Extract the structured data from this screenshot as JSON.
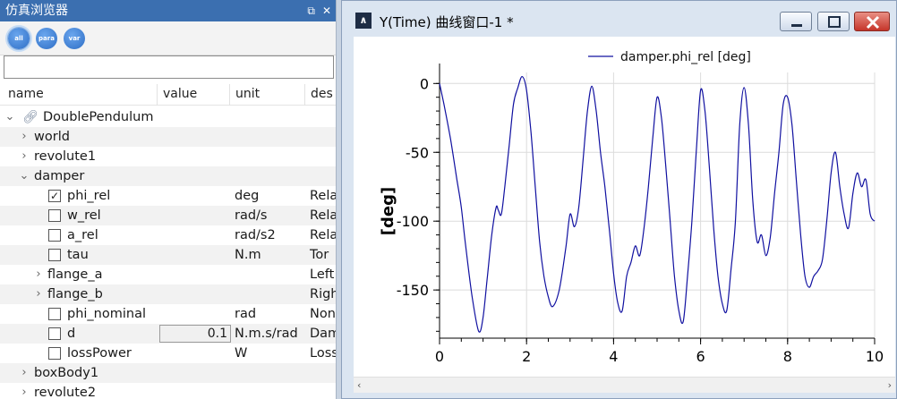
{
  "browser": {
    "title": "仿真浏览器",
    "filters": [
      "all",
      "para",
      "var"
    ],
    "search": {
      "value": "",
      "placeholder": ""
    },
    "columns": {
      "name": "name",
      "value": "value",
      "unit": "unit",
      "desc": "des"
    },
    "rows": [
      {
        "name": "DoublePendulum",
        "unit": "",
        "desc": "",
        "value": ""
      },
      {
        "name": "world",
        "unit": "",
        "desc": "",
        "value": ""
      },
      {
        "name": "revolute1",
        "unit": "",
        "desc": "",
        "value": ""
      },
      {
        "name": "damper",
        "unit": "",
        "desc": "",
        "value": ""
      },
      {
        "name": "phi_rel",
        "unit": "deg",
        "desc": "Rela",
        "value": ""
      },
      {
        "name": "w_rel",
        "unit": "rad/s",
        "desc": "Rela",
        "value": ""
      },
      {
        "name": "a_rel",
        "unit": "rad/s2",
        "desc": "Rela",
        "value": ""
      },
      {
        "name": "tau",
        "unit": "N.m",
        "desc": "Tor",
        "value": ""
      },
      {
        "name": "flange_a",
        "unit": "",
        "desc": "Left",
        "value": ""
      },
      {
        "name": "flange_b",
        "unit": "",
        "desc": "Righ",
        "value": ""
      },
      {
        "name": "phi_nominal",
        "unit": "rad",
        "desc": "Non",
        "value": ""
      },
      {
        "name": "d",
        "unit": "N.m.s/rad",
        "desc": "Dam",
        "value": "0.1"
      },
      {
        "name": "lossPower",
        "unit": "W",
        "desc": "Loss",
        "value": ""
      },
      {
        "name": "boxBody1",
        "unit": "",
        "desc": "",
        "value": ""
      },
      {
        "name": "revolute2",
        "unit": "",
        "desc": "",
        "value": ""
      }
    ]
  },
  "plot_window": {
    "title": "Y(Time) 曲线窗口-1 *",
    "icon": "modelica-logo-icon"
  },
  "chart_data": {
    "type": "line",
    "title": "",
    "xlabel": "",
    "ylabel": "[deg]",
    "xlim": [
      0,
      10
    ],
    "ylim": [
      -185,
      8
    ],
    "xticks": [
      "0",
      "2",
      "4",
      "6",
      "8",
      "10"
    ],
    "yticks": [
      "0",
      "-50",
      "-100",
      "-150"
    ],
    "grid": true,
    "legend_position": "top",
    "series": [
      {
        "name": "damper.phi_rel [deg]",
        "color": "#1010a0",
        "x": [
          0,
          0.1,
          0.25,
          0.4,
          0.5,
          0.6,
          0.75,
          0.9,
          1.0,
          1.1,
          1.2,
          1.3,
          1.35,
          1.42,
          1.5,
          1.6,
          1.7,
          1.8,
          1.9,
          2.0,
          2.1,
          2.2,
          2.3,
          2.4,
          2.5,
          2.6,
          2.75,
          2.9,
          3.0,
          3.1,
          3.2,
          3.3,
          3.4,
          3.5,
          3.6,
          3.7,
          3.8,
          3.9,
          4.0,
          4.1,
          4.2,
          4.3,
          4.4,
          4.5,
          4.6,
          4.7,
          4.8,
          4.9,
          5.0,
          5.1,
          5.2,
          5.3,
          5.4,
          5.5,
          5.6,
          5.7,
          5.8,
          5.9,
          6.0,
          6.1,
          6.2,
          6.3,
          6.4,
          6.5,
          6.6,
          6.7,
          6.8,
          6.9,
          7.0,
          7.1,
          7.2,
          7.3,
          7.4,
          7.5,
          7.6,
          7.7,
          7.8,
          7.9,
          8.0,
          8.1,
          8.2,
          8.3,
          8.4,
          8.5,
          8.6,
          8.7,
          8.8,
          8.9,
          9.0,
          9.1,
          9.2,
          9.3,
          9.4,
          9.5,
          9.6,
          9.7,
          9.8,
          9.9,
          10.0
        ],
        "y": [
          0,
          -15,
          -40,
          -70,
          -90,
          -118,
          -155,
          -180,
          -170,
          -140,
          -110,
          -90,
          -92,
          -95,
          -75,
          -45,
          -15,
          -3,
          5,
          -5,
          -35,
          -75,
          -115,
          -140,
          -155,
          -162,
          -150,
          -120,
          -95,
          -104,
          -90,
          -55,
          -20,
          -2,
          -20,
          -50,
          -75,
          -105,
          -138,
          -160,
          -165,
          -140,
          -130,
          -118,
          -125,
          -105,
          -75,
          -40,
          -10,
          -25,
          -60,
          -100,
          -140,
          -165,
          -173,
          -140,
          -100,
          -50,
          -5,
          -20,
          -60,
          -105,
          -140,
          -160,
          -165,
          -135,
          -100,
          -30,
          -3,
          -30,
          -85,
          -115,
          -110,
          -125,
          -112,
          -80,
          -50,
          -15,
          -10,
          -30,
          -70,
          -110,
          -140,
          -148,
          -140,
          -136,
          -128,
          -100,
          -65,
          -50,
          -75,
          -95,
          -105,
          -80,
          -65,
          -75,
          -70,
          -95,
          -100
        ]
      }
    ]
  }
}
